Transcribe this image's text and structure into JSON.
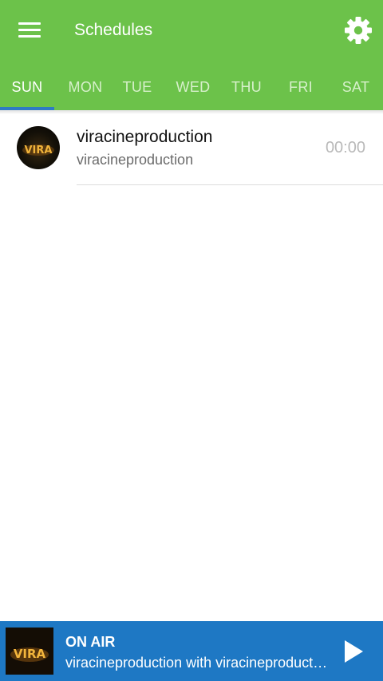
{
  "header": {
    "title": "Schedules",
    "menu_icon": "hamburger-menu-icon",
    "settings_icon": "gear-icon",
    "background_color": "#6cc24a"
  },
  "tabs": [
    {
      "label": "SUN",
      "active": true
    },
    {
      "label": "MON",
      "active": false
    },
    {
      "label": "TUE",
      "active": false
    },
    {
      "label": "WED",
      "active": false
    },
    {
      "label": "THU",
      "active": false
    },
    {
      "label": "FRI",
      "active": false
    },
    {
      "label": "SAT",
      "active": false
    }
  ],
  "tab_indicator_color": "#2e7bc4",
  "schedule": [
    {
      "title": "viracineproduction",
      "subtitle": "viracineproduction",
      "time": "00:00",
      "logo_text": "VIRA"
    }
  ],
  "player": {
    "status": "ON AIR",
    "now_playing": "viracineproduction with viracineproduction",
    "logo_text": "VIRA",
    "play_icon": "play-icon",
    "background_color": "#1e78c4"
  }
}
